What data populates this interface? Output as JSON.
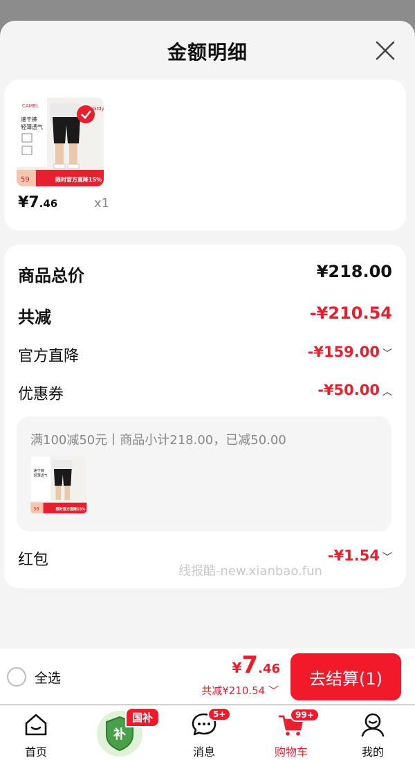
{
  "sheet": {
    "title": "金额明细"
  },
  "product": {
    "price_int": "¥7",
    "price_dec": ".46",
    "qty": "x1",
    "thumb_texts": {
      "brand": "CAMEL",
      "line1": "速干裤",
      "line2": "轻薄透气",
      "badge_tag": "Grdy",
      "promo_price": "59",
      "promo": "限时官方直降15%"
    }
  },
  "summary": {
    "total_label": "商品总价",
    "total_value": "¥218.00",
    "reduce_label": "共减",
    "reduce_value": "-¥210.54",
    "official_label": "官方直降",
    "official_value": "-¥159.00",
    "coupon_label": "优惠券",
    "coupon_value": "-¥50.00",
    "coupon_desc": "满100减50元丨商品小计218.00，已减50.00",
    "redpack_label": "红包",
    "redpack_value": "-¥1.54"
  },
  "watermark": "线报酷-new.xianbao.fun",
  "checkout": {
    "select_all": "全选",
    "pay_yen": "¥",
    "pay_int": "7",
    "pay_dec": ".46",
    "pay_reduce": "共减¥210.54",
    "button": "去结算(1)"
  },
  "tabs": {
    "home": "首页",
    "gov_badge": "国补",
    "gov_icon_char": "补",
    "messages": "消息",
    "messages_badge": "5+",
    "cart": "购物车",
    "cart_badge": "99+",
    "mine": "我的"
  },
  "colors": {
    "accent_red": "#e8202e",
    "button_red": "#f2192a",
    "gov_green": "#3a8f3a"
  }
}
